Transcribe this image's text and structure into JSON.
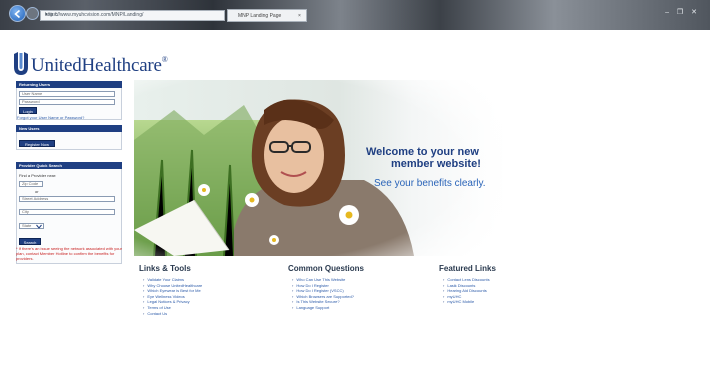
{
  "browser": {
    "address": "https://www.myuhcvision.com/MNP/Landing/",
    "tab_title": "MNP Landing Page",
    "tab_close": "×",
    "addr_icons": "▾ ⊕ ↻",
    "window_controls": "– ❐ ✕"
  },
  "logo": {
    "text": "UnitedHealthcare",
    "trademark": "®"
  },
  "returning_users": {
    "heading": "Returning Users",
    "username_placeholder": "User Name",
    "password_placeholder": "Password",
    "login_label": "Login",
    "forgot_text": "Forgot your User Name or Password?"
  },
  "new_users": {
    "heading": "New Users",
    "register_label": "Register Now"
  },
  "provider_search": {
    "heading": "Provider Quick Search",
    "find_label": "Find a Provider near:",
    "zip_placeholder": "Zip Code",
    "or_label": "or",
    "street_placeholder": "Street Address",
    "city_placeholder": "City",
    "state_value": "State",
    "search_label": "Search",
    "disclaimer": "* If there's an issue seeing the network associated with your plan, contact Member Hotline to confirm the benefits for providers."
  },
  "hero": {
    "welcome_line1": "Welcome to your new",
    "welcome_line2": "member website!",
    "tagline": "See your benefits clearly."
  },
  "links_tools": {
    "heading": "Links & Tools",
    "items": [
      "Validate Your Claims",
      "Why Choose UnitedHealthcare",
      "Which Eyewear is Best for Me",
      "Eye Wellness Videos",
      "Legal Notices & Privacy",
      "Terms of Use",
      "Contact Us"
    ]
  },
  "common_questions": {
    "heading": "Common Questions",
    "items": [
      "Who Can Use This Website",
      "How Do I Register",
      "How Do I Register (VSCC)",
      "Which Browsers are Supported?",
      "Is This Website Secure?",
      "Language Support"
    ]
  },
  "featured_links": {
    "heading": "Featured Links",
    "items": [
      "Contact Lens Discounts",
      "Lasik Discounts",
      "Hearing Aid Discounts",
      "myUHC",
      "myUHC Mobile"
    ]
  },
  "colors": {
    "brand_navy": "#1f3f82",
    "link_blue": "#2b5aa8",
    "warning_red": "#c82020"
  }
}
